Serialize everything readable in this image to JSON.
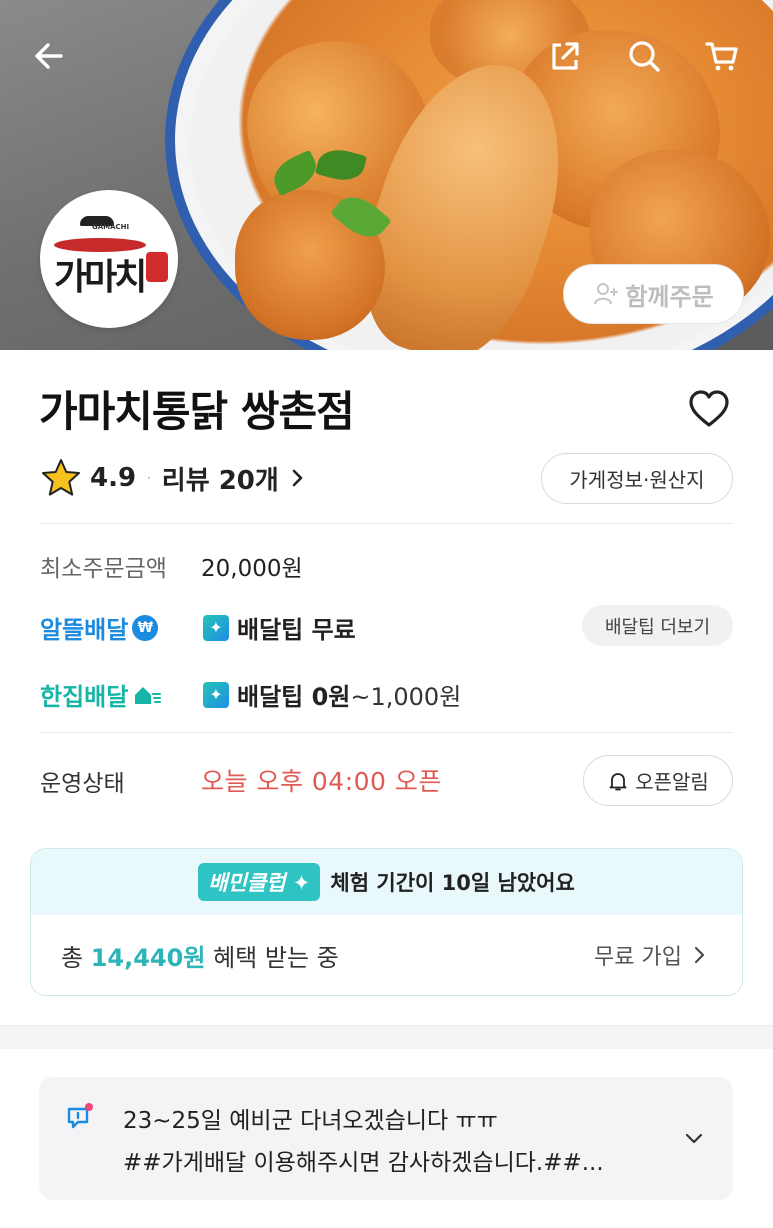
{
  "header": {
    "icons": [
      "back-arrow-icon",
      "share-icon",
      "search-icon",
      "cart-icon"
    ]
  },
  "hero": {
    "logo_brand": "가마치",
    "logo_small": "GAMACHI",
    "together_order_label": "함께주문"
  },
  "store": {
    "name": "가마치통닭 쌍촌점",
    "rating": "4.9",
    "separator": "·",
    "review_label": "리뷰 20개",
    "info_button_label": "가게정보·원산지"
  },
  "min_order": {
    "label": "최소주문금액",
    "value": "20,000원"
  },
  "delivery": {
    "saver": {
      "label": "알뜰배달",
      "tip_label": "배달팁 무료"
    },
    "single": {
      "label": "한집배달",
      "tip_label": "배달팁 0원",
      "tip_range": "~1,000원"
    },
    "more_tip_button": "배달팁 더보기"
  },
  "status": {
    "label": "운영상태",
    "value": "오늘 오후 04:00 오픈",
    "alarm_button": "오픈알림"
  },
  "club": {
    "badge": "배민클럽",
    "trial_message": "체험 기간이 10일 남았어요",
    "benefit_prefix": "총",
    "benefit_amount": "14,440원",
    "benefit_suffix": "혜택 받는 중",
    "join_label": "무료 가입"
  },
  "notice": {
    "line1": "23~25일 예비군 다녀오겠습니다 ㅠㅠ",
    "line2": "##가게배달 이용해주시면 감사하겠습니다.##..."
  },
  "colors": {
    "blue": "#1b8be0",
    "teal": "#17b5a8",
    "status_red": "#e05a52",
    "club_teal": "#2fc3c4"
  }
}
